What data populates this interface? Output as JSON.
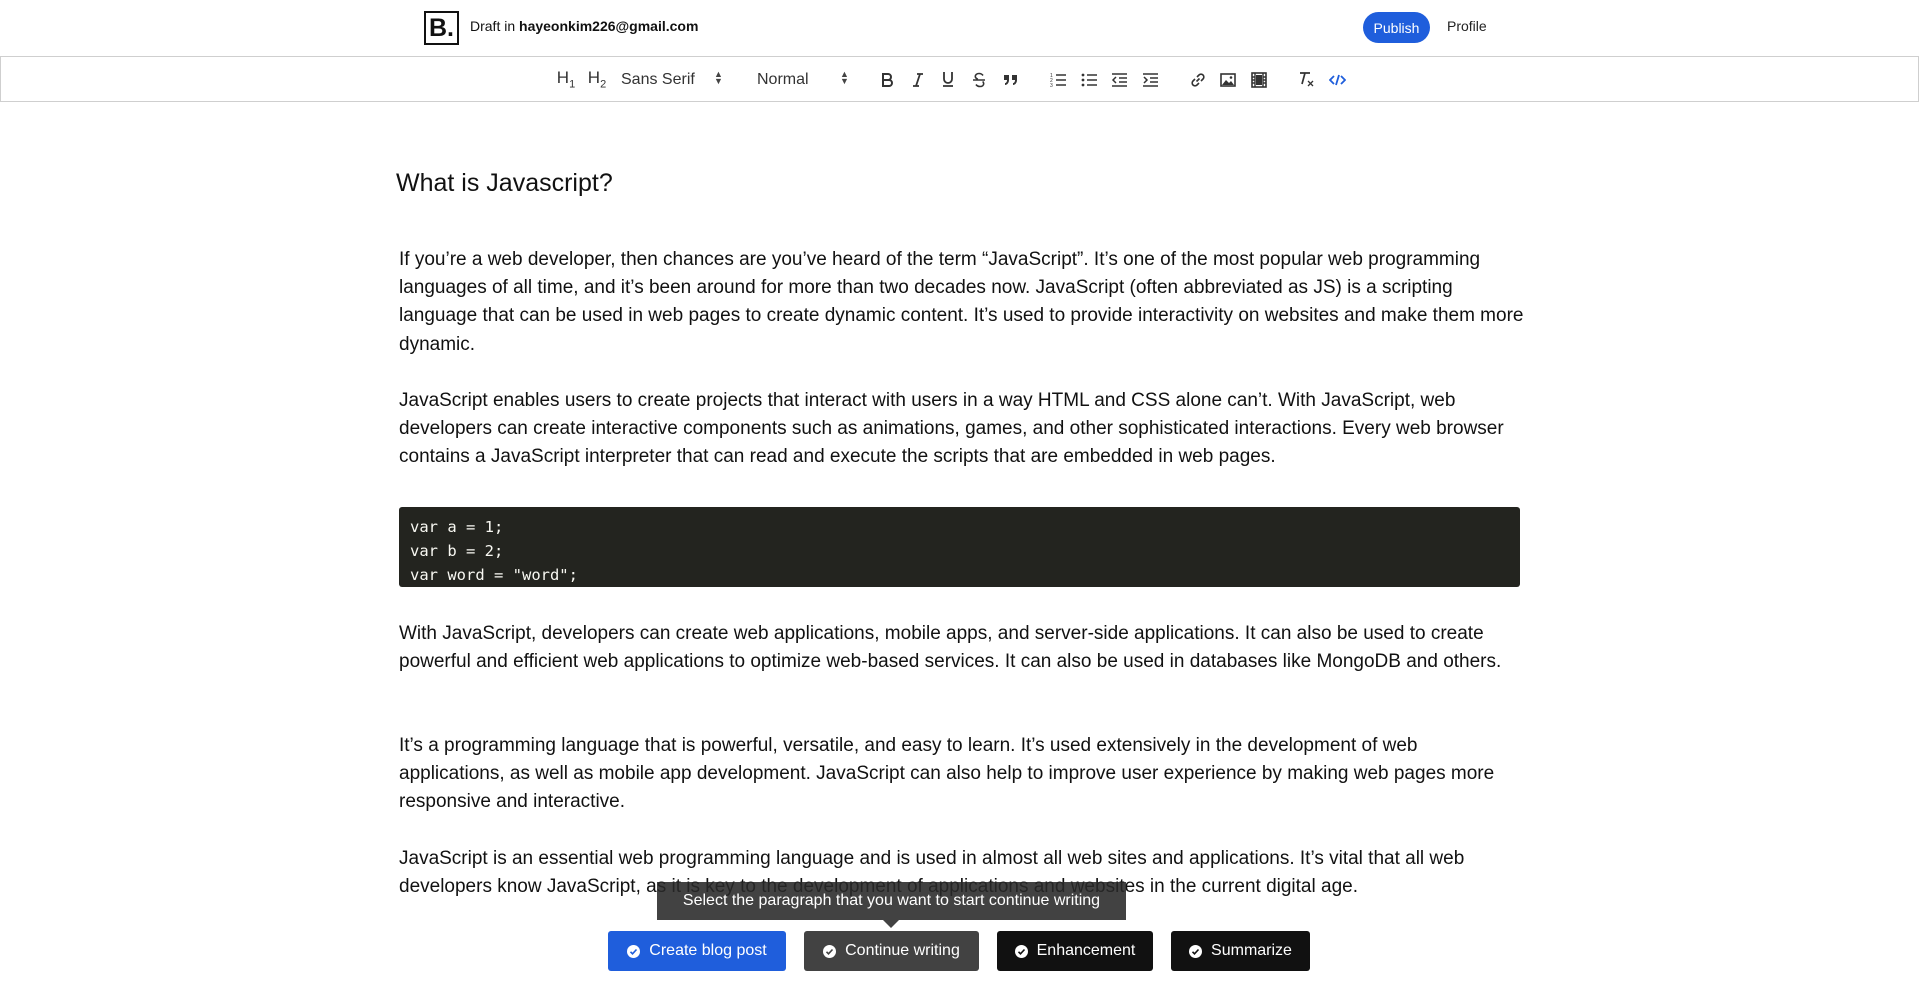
{
  "header": {
    "logo_text": "B.",
    "draft_prefix": "Draft in",
    "draft_account": "hayeonkim226@gmail.com",
    "publish_label": "Publish",
    "profile_label": "Profile"
  },
  "toolbar": {
    "h1_label": "H1",
    "h2_label": "H2",
    "font_family": "Sans Serif",
    "font_size": "Normal",
    "icons": [
      "bold-icon",
      "italic-icon",
      "underline-icon",
      "strikethrough-icon",
      "blockquote-icon",
      "ordered-list-icon",
      "bullet-list-icon",
      "outdent-icon",
      "indent-icon",
      "link-icon",
      "image-icon",
      "video-icon",
      "clear-format-icon",
      "code-block-icon"
    ]
  },
  "document": {
    "title": "What is Javascript?",
    "paragraphs": [
      "If you’re a web developer, then chances are you’ve heard of the term “JavaScript”. It’s one of the most popular web programming languages of all time, and it’s been around for more than two decades now. JavaScript (often abbreviated as JS) is a scripting language that can be used in web pages to create dynamic content. It’s used to provide interactivity on websites and make them more dynamic.",
      "JavaScript enables users to create projects that interact with users in a way HTML and CSS alone can’t. With JavaScript, web developers can create interactive components such as animations, games, and other sophisticated interactions. Every web browser contains a JavaScript interpreter that can read and execute the scripts that are embedded in web pages.",
      "With JavaScript, developers can create web applications, mobile apps, and server-side applications. It can also be used to create powerful and efficient web applications to optimize web-based services. It can also be used in databases like MongoDB and others.",
      "It’s a programming language that is powerful, versatile, and easy to learn. It’s used extensively in the development of web applications, as well as mobile app development. JavaScript can also help to improve user experience by making web pages more responsive and interactive.",
      "JavaScript is an essential web programming language and is used in almost all web sites and applications. It’s vital that all web developers know JavaScript, as it is key to the development of applications and websites in the current digital age."
    ],
    "code_lines": [
      "var a = 1;",
      "var b = 2;",
      "var word = \"word\";"
    ]
  },
  "tooltip": {
    "text": "Select the paragraph that you want to start continue writing"
  },
  "actions": {
    "create_label": "Create blog post",
    "continue_label": "Continue writing",
    "enhance_label": "Enhancement",
    "summarize_label": "Summarize"
  },
  "colors": {
    "accent": "#1f5edc",
    "code_bg": "#23241f",
    "active_button": "#424242",
    "dark_button": "#111111"
  }
}
